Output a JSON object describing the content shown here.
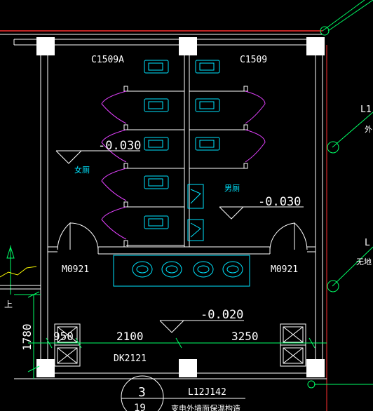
{
  "colors": {
    "background": "#000000",
    "wall": "#ffffff",
    "fixture": "#00e5ff",
    "door_swing": "#e040fb",
    "dimension": "#00ff66",
    "axis": "#ff3030",
    "leader": "#ffff00"
  },
  "labels": {
    "window_left": "C1509A",
    "window_right": "C1509",
    "female_wc": "女厕",
    "male_wc": "男厕",
    "door_left": "M0921",
    "door_right": "M0921",
    "door_bottom": "DK2121",
    "elev_left": "-0.030",
    "elev_right": "-0.030",
    "elev_bottom": "-0.020",
    "dim_1": "950",
    "dim_2": "2100",
    "dim_3": "3250",
    "dim_vertical": "1780",
    "detail_number": "3",
    "detail_sheet": "19",
    "detail_ref": "L12J142",
    "detail_note": "变电外墙面保温构造",
    "right_tag_1": "L1",
    "right_tag_1_note": "外",
    "right_tag_2": "L",
    "right_tag_2_note": "无地",
    "left_mark": "上"
  }
}
